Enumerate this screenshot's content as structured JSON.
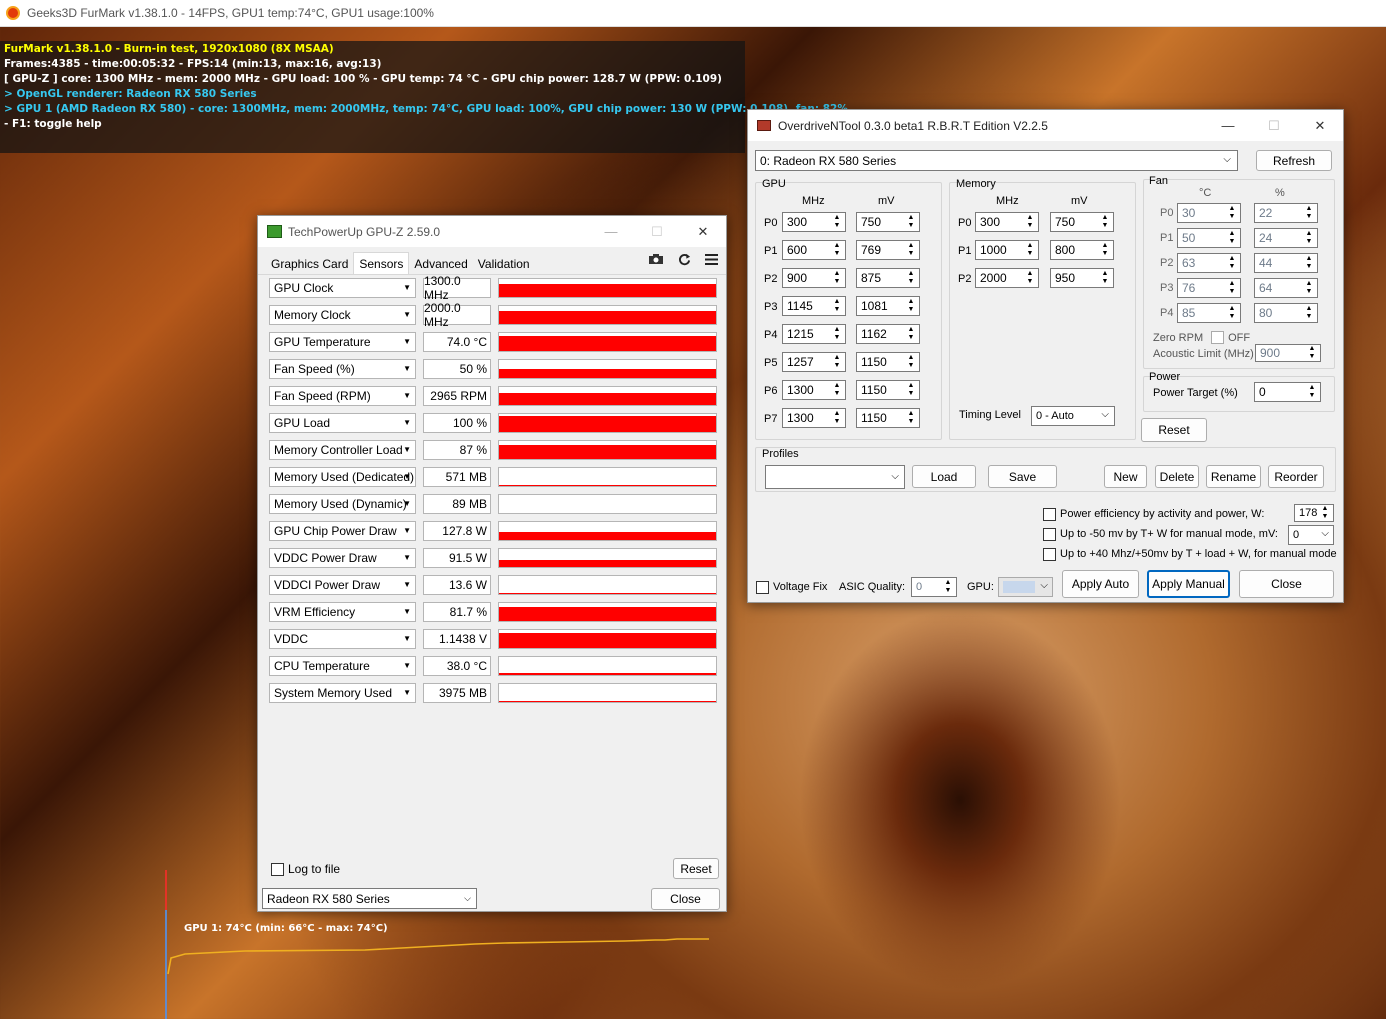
{
  "main_title": "Geeks3D FurMark v1.38.1.0 - 14FPS, GPU1 temp:74°C, GPU1 usage:100%",
  "overlay": {
    "lines": [
      {
        "text": "FurMark v1.38.1.0 - Burn-in test, 1920x1080 (8X MSAA)",
        "color": "#ffff00"
      },
      {
        "text": "Frames:4385 - time:00:05:32 - FPS:14 (min:13, max:16, avg:13)",
        "color": "#ffffff"
      },
      {
        "text": "[ GPU-Z ] core: 1300 MHz - mem: 2000 MHz - GPU load: 100 % - GPU temp: 74 °C - GPU chip power: 128.7 W (PPW: 0.109)",
        "color": "#ffffff"
      },
      {
        "text": "> OpenGL renderer: Radeon RX 580 Series",
        "color": "#36c8f0"
      },
      {
        "text": "> GPU 1 (AMD Radeon RX 580) - core: 1300MHz, mem: 2000MHz, temp: 74°C, GPU load: 100%, GPU chip power: 130 W (PPW: 0.108), fan: 82%",
        "color": "#36c8f0"
      },
      {
        "text": "- F1: toggle help",
        "color": "#ffffff"
      }
    ]
  },
  "gpuz": {
    "title": "TechPowerUp GPU-Z 2.59.0",
    "tabs": [
      "Graphics Card",
      "Sensors",
      "Advanced",
      "Validation"
    ],
    "sensors": [
      {
        "name": "GPU Clock",
        "value": "1300.0 MHz",
        "level": 0.7
      },
      {
        "name": "Memory Clock",
        "value": "2000.0 MHz",
        "level": 0.7
      },
      {
        "name": "GPU Temperature",
        "value": "74.0 °C",
        "level": 0.85
      },
      {
        "name": "Fan Speed (%)",
        "value": "50 %",
        "level": 0.5
      },
      {
        "name": "Fan Speed (RPM)",
        "value": "2965 RPM",
        "level": 0.65
      },
      {
        "name": "GPU Load",
        "value": "100 %",
        "level": 0.9
      },
      {
        "name": "Memory Controller Load",
        "value": "87 %",
        "level": 0.8
      },
      {
        "name": "Memory Used (Dedicated)",
        "value": "571 MB",
        "level": 0.07
      },
      {
        "name": "Memory Used (Dynamic)",
        "value": "89 MB",
        "level": 0.02
      },
      {
        "name": "GPU Chip Power Draw",
        "value": "127.8 W",
        "level": 0.45
      },
      {
        "name": "VDDC Power Draw",
        "value": "91.5 W",
        "level": 0.4
      },
      {
        "name": "VDDCI Power Draw",
        "value": "13.6 W",
        "level": 0.06
      },
      {
        "name": "VRM Efficiency",
        "value": "81.7 %",
        "level": 0.8
      },
      {
        "name": "VDDC",
        "value": "1.1438 V",
        "level": 0.85
      },
      {
        "name": "CPU Temperature",
        "value": "38.0 °C",
        "level": 0.12
      },
      {
        "name": "System Memory Used",
        "value": "3975 MB",
        "level": 0.03
      }
    ],
    "log_label": "Log to file",
    "reset_label": "Reset",
    "gpu_select": "Radeon RX 580 Series",
    "close_label": "Close"
  },
  "odnt": {
    "title": "OverdriveNTool 0.3.0 beta1 R.B.R.T Edition V2.2.5",
    "gpu_select": "0: Radeon RX 580 Series",
    "refresh_label": "Refresh",
    "gpu": {
      "label": "GPU",
      "mhz_label": "MHz",
      "mv_label": "mV",
      "states": [
        {
          "p": "P0",
          "mhz": "300",
          "mv": "750"
        },
        {
          "p": "P1",
          "mhz": "600",
          "mv": "769"
        },
        {
          "p": "P2",
          "mhz": "900",
          "mv": "875"
        },
        {
          "p": "P3",
          "mhz": "1145",
          "mv": "1081"
        },
        {
          "p": "P4",
          "mhz": "1215",
          "mv": "1162"
        },
        {
          "p": "P5",
          "mhz": "1257",
          "mv": "1150"
        },
        {
          "p": "P6",
          "mhz": "1300",
          "mv": "1150"
        },
        {
          "p": "P7",
          "mhz": "1300",
          "mv": "1150"
        }
      ]
    },
    "memory": {
      "label": "Memory",
      "mhz_label": "MHz",
      "mv_label": "mV",
      "states": [
        {
          "p": "P0",
          "mhz": "300",
          "mv": "750"
        },
        {
          "p": "P1",
          "mhz": "1000",
          "mv": "800"
        },
        {
          "p": "P2",
          "mhz": "2000",
          "mv": "950"
        }
      ],
      "timing_label": "Timing Level",
      "timing_value": "0 - Auto"
    },
    "fan": {
      "label": "Fan",
      "c_label": "°C",
      "pct_label": "%",
      "states": [
        {
          "p": "P0",
          "c": "30",
          "pct": "22"
        },
        {
          "p": "P1",
          "c": "50",
          "pct": "24"
        },
        {
          "p": "P2",
          "c": "63",
          "pct": "44"
        },
        {
          "p": "P3",
          "c": "76",
          "pct": "64"
        },
        {
          "p": "P4",
          "c": "85",
          "pct": "80"
        }
      ],
      "zero_rpm_label": "Zero RPM",
      "zero_rpm_state": "OFF",
      "acoustic_label": "Acoustic Limit (MHz)",
      "acoustic_value": "900"
    },
    "power": {
      "label": "Power",
      "target_label": "Power Target (%)",
      "target_value": "0"
    },
    "reset_label": "Reset",
    "profiles": {
      "label": "Profiles",
      "load": "Load",
      "save": "Save",
      "new": "New",
      "delete": "Delete",
      "rename": "Rename",
      "reorder": "Reorder"
    },
    "opt1": {
      "label": "Power efficiency by activity and power, W:",
      "value": "178"
    },
    "opt2": {
      "label": "Up to -50 mv by T+ W  for manual mode, mV:",
      "value": "0"
    },
    "opt3": {
      "label": "Up to +40 Mhz/+50mv by T + load + W, for manual mode"
    },
    "voltage_fix_label": "Voltage Fix",
    "asic_label": "ASIC Quality:",
    "asic_value": "0",
    "gpu_label": "GPU:",
    "apply_auto": "Apply Auto",
    "apply_manual": "Apply Manual",
    "close": "Close"
  },
  "temp_graph": {
    "label": "GPU 1: 74°C (min: 66°C - max: 74°C)"
  }
}
